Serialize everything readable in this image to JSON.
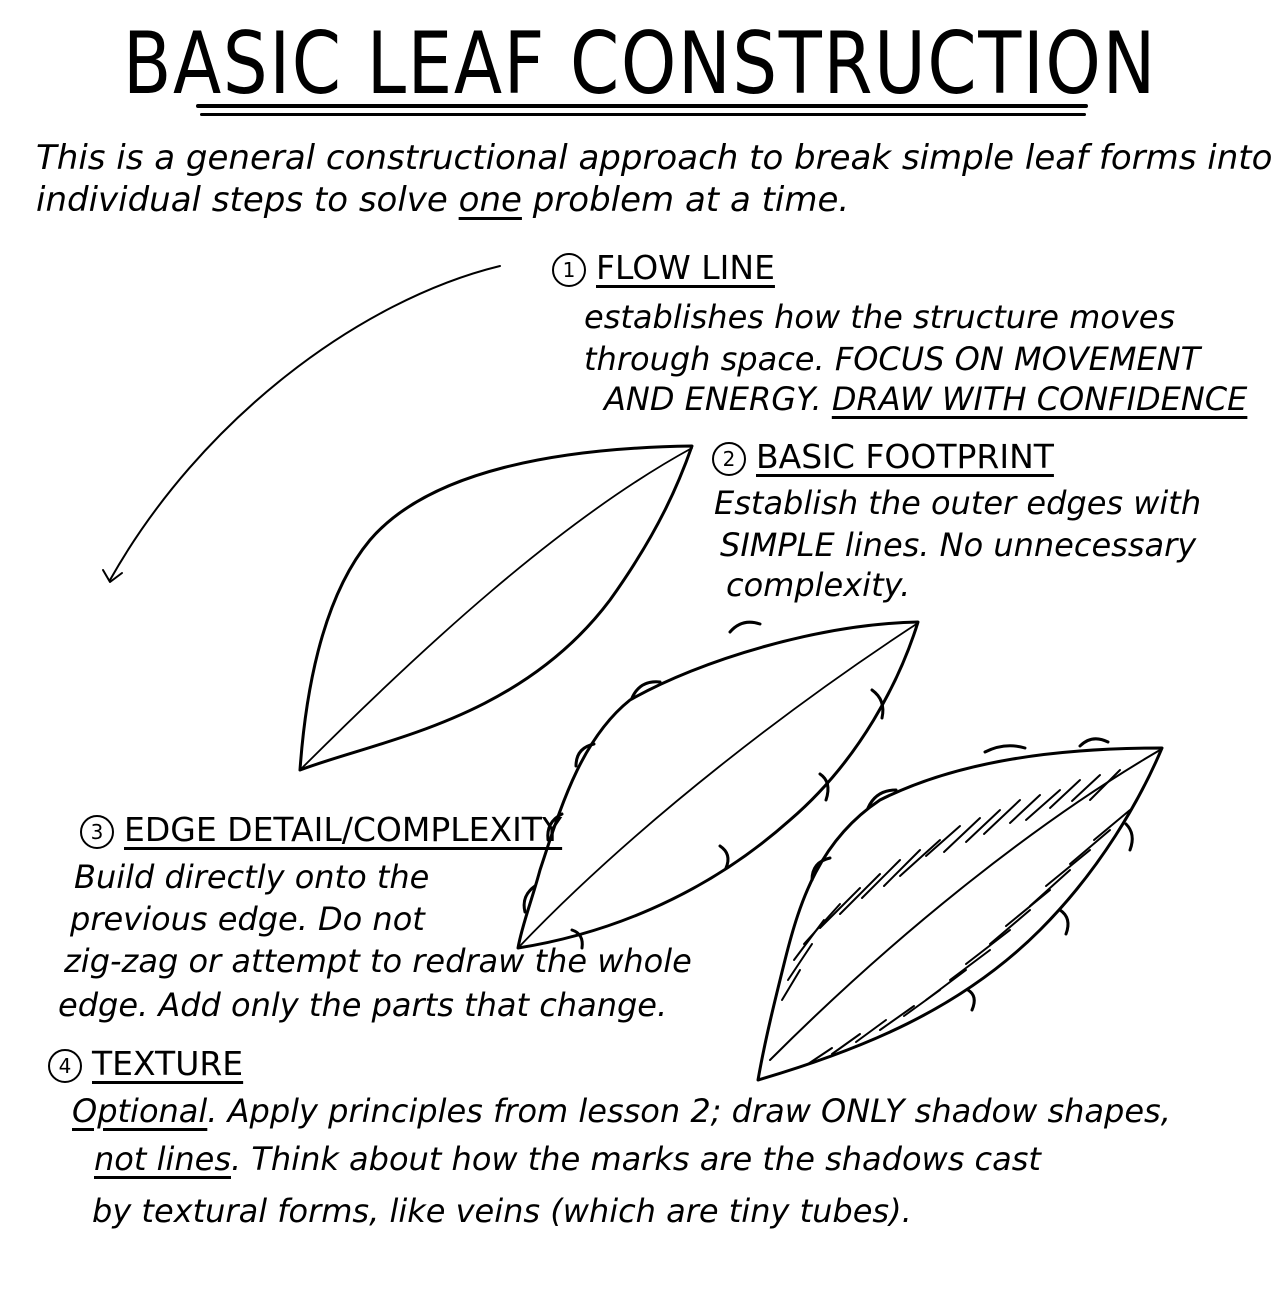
{
  "title": "BASIC LEAF CONSTRUCTION",
  "intro": {
    "line1": "This is a general constructional approach to break simple leaf forms into",
    "line2_before": "individual steps to solve ",
    "line2_emph": "one",
    "line2_after": " problem at a time."
  },
  "steps": [
    {
      "number": "1",
      "title": "FLOW LINE",
      "lines": [
        "establishes how the structure moves",
        "through space. FOCUS ON MOVEMENT"
      ],
      "line3_before": "AND ENERGY. ",
      "line3_emph": "DRAW WITH CONFIDENCE"
    },
    {
      "number": "2",
      "title": "BASIC FOOTPRINT",
      "lines": [
        "Establish the outer edges with",
        "SIMPLE lines. No unnecessary",
        "complexity."
      ]
    },
    {
      "number": "3",
      "title": "EDGE DETAIL/COMPLEXITY",
      "lines": [
        "Build directly onto the",
        "previous edge. Do not",
        "zig-zag or attempt to  redraw the whole",
        "edge. Add only the parts that change."
      ]
    },
    {
      "number": "4",
      "title": "TEXTURE",
      "line1_emph": "Optional",
      "line1_after": ". Apply principles from lesson 2; draw ONLY shadow shapes,",
      "line2_emph": "not lines",
      "line2_after": ". Think about how the marks are the shadows cast",
      "line3": "by textural forms, like veins (which are tiny tubes)."
    }
  ]
}
